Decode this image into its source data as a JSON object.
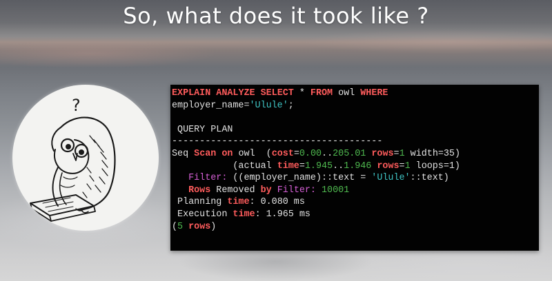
{
  "slide": {
    "title": "So, what does it took like ?"
  },
  "illustration": {
    "question_mark": "?"
  },
  "terminal": {
    "query_line1": {
      "explain": "EXPLAIN",
      "analyze": "ANALYZE",
      "select": "SELECT",
      "star": " * ",
      "from": "FROM",
      "table": " owl ",
      "where": "WHERE"
    },
    "query_line2": {
      "column": "employer_name=",
      "value": "'Ulule'",
      "end": ";"
    },
    "plan_header": " QUERY PLAN",
    "separator": "--------------------------------------",
    "seq_scan": {
      "seq": "Seq ",
      "scan": "Scan",
      "on": "on",
      "table": " owl  (",
      "cost_kw": "cost",
      "eq1": "=",
      "cost_start": "0.00",
      "dots1": "..",
      "cost_end": "205.01",
      "rows_kw": "rows",
      "eq2": "=",
      "rows_val": "1",
      "width": " width=35)"
    },
    "actual": {
      "indent": "           (actual ",
      "time_kw": "time",
      "eq1": "=",
      "time_start": "1.945",
      "dots": "..",
      "time_end": "1.946",
      "rows_kw": "rows",
      "eq2": "=",
      "rows_val": "1",
      "loops": " loops=1)"
    },
    "filter": {
      "indent": "   ",
      "label": "Filter:",
      "expr_start": " ((employer_name)::text = ",
      "value": "'Ulule'",
      "expr_end": "::text)"
    },
    "rows_removed": {
      "indent": "   ",
      "rows_kw": "Rows",
      "removed": " Removed ",
      "by_kw": "by",
      "filter_label": "Filter:",
      "count": "10001"
    },
    "planning": {
      "label": " Planning ",
      "time_kw": "time",
      "value": ": 0.080 ms"
    },
    "execution": {
      "label": " Execution ",
      "time_kw": "time",
      "value": ": 1.965 ms"
    },
    "row_count": {
      "open": "(",
      "count": "5",
      "rows_kw": "rows",
      "close": ")"
    }
  }
}
